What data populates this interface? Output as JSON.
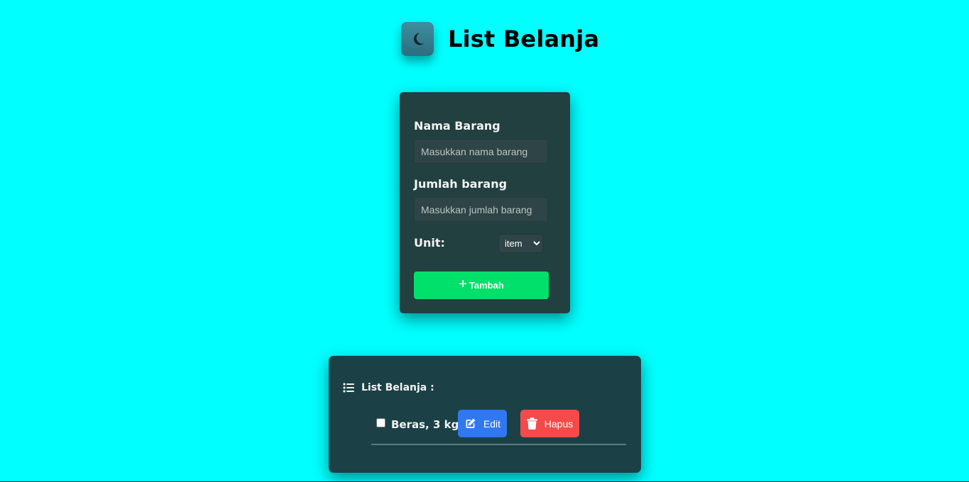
{
  "header": {
    "title": "List Belanja",
    "theme_toggle_icon": "moon-icon"
  },
  "form": {
    "name_label": "Nama Barang",
    "name_placeholder": "Masukkan nama barang",
    "name_value": "",
    "quantity_label": "Jumlah barang",
    "quantity_placeholder": "Masukkan jumlah barang",
    "quantity_value": "",
    "unit_label": "Unit:",
    "unit_selected": "item",
    "add_button_icon": "plus-icon",
    "add_button_label": "Tambah"
  },
  "list": {
    "header_icon": "list-icon",
    "title": "List Belanja :",
    "items": [
      {
        "text": "Beras, 3 kg",
        "checked": false,
        "edit_label": "Edit",
        "edit_icon": "edit-icon",
        "delete_label": "Hapus",
        "delete_icon": "trash-icon"
      }
    ]
  },
  "colors": {
    "page_background": "#00ffff",
    "card_background": "#21403f",
    "add_button": "#00e06a",
    "edit_button": "#2f78f0",
    "delete_button": "#f54a4a"
  }
}
